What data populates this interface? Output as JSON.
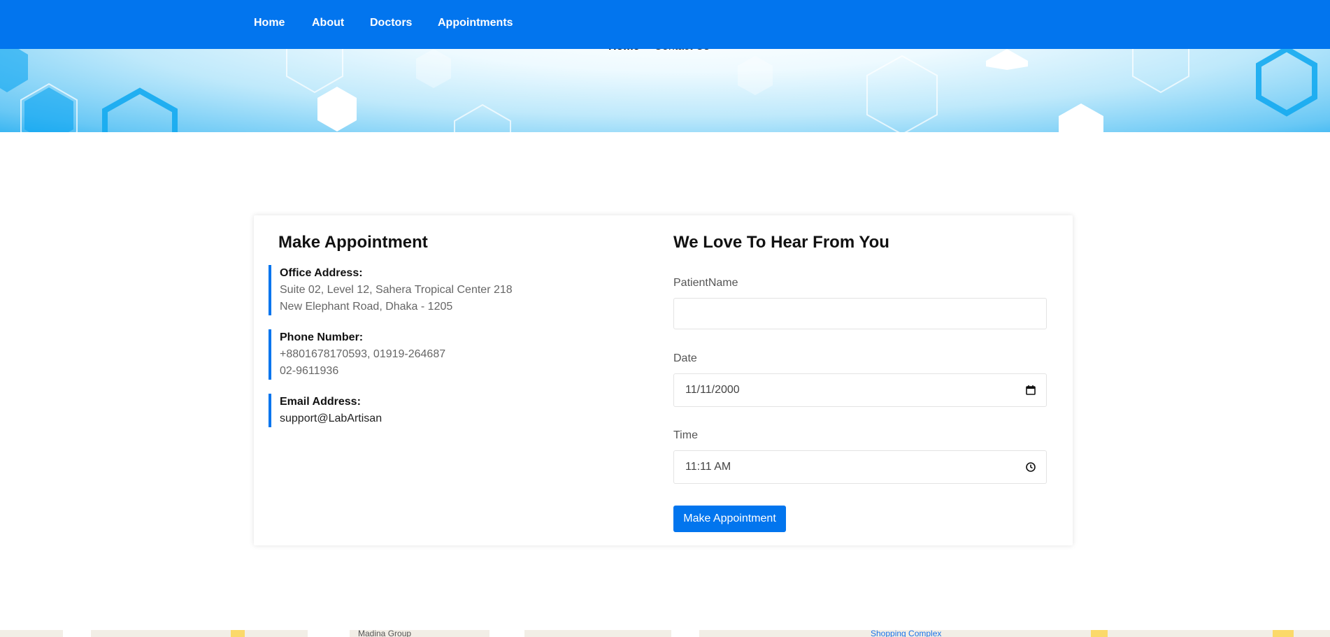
{
  "nav": {
    "items": [
      {
        "label": "Home"
      },
      {
        "label": "About"
      },
      {
        "label": "Doctors"
      },
      {
        "label": "Appointments"
      }
    ]
  },
  "breadcrumb": {
    "home": "Home",
    "separator": "–",
    "current": "Contact Us"
  },
  "contact": {
    "title": "Make Appointment",
    "office": {
      "label": "Office Address:",
      "lines": [
        "Suite 02, Level 12, Sahera Tropical Center 218",
        "New Elephant Road, Dhaka - 1205"
      ]
    },
    "phone": {
      "label": "Phone Number:",
      "lines": [
        "+8801678170593, 01919-264687",
        "02-9611936"
      ]
    },
    "email": {
      "label": "Email Address:",
      "value": "support@LabArtisan"
    }
  },
  "form": {
    "title": "We Love To Hear From You",
    "patient_label": "PatientName",
    "patient_value": "",
    "date_label": "Date",
    "date_value": "11/11/2000",
    "time_label": "Time",
    "time_value": "11:11 AM",
    "submit_label": "Make Appointment"
  },
  "map": {
    "labels": [
      "Madina Group",
      "Shopping Complex"
    ]
  },
  "colors": {
    "primary": "#0275ee",
    "accent_border": "#0275ee"
  }
}
